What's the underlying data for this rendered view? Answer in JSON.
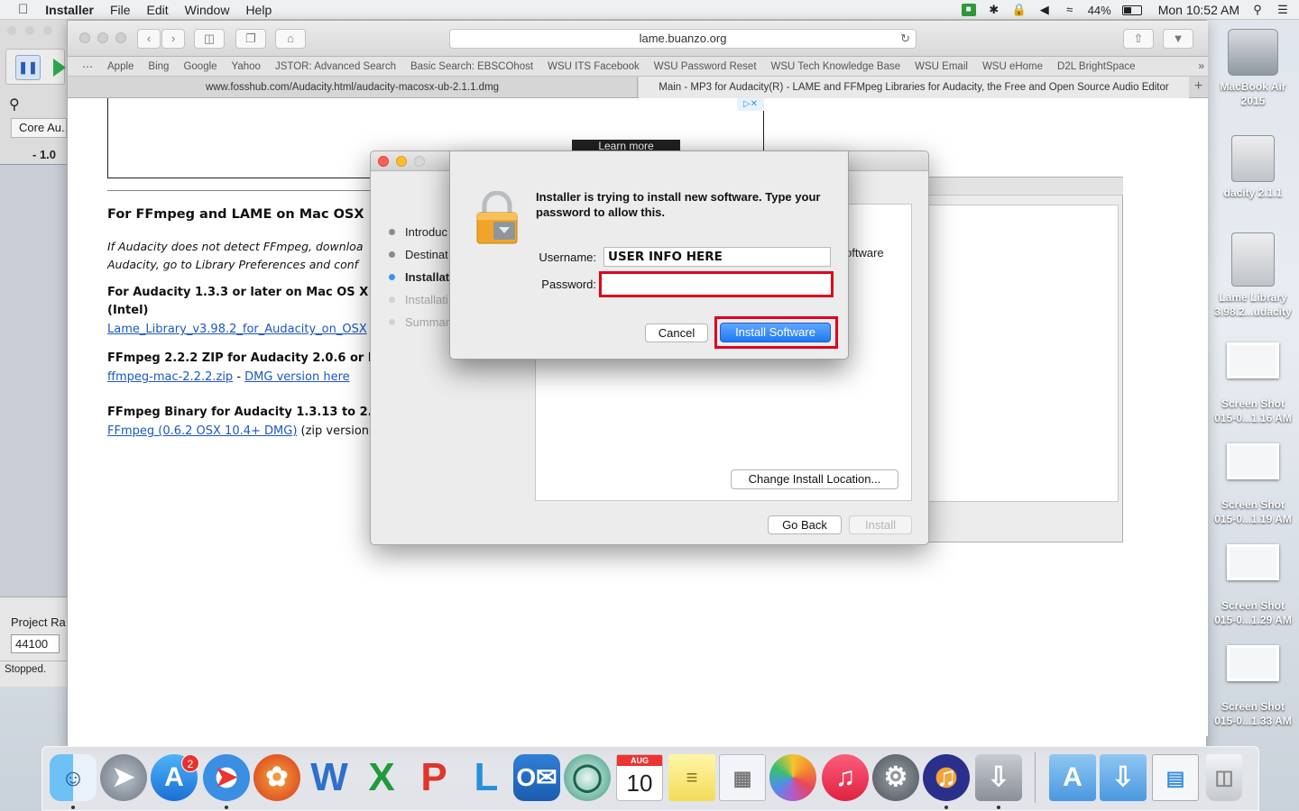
{
  "menubar": {
    "apple": "",
    "app": "Installer",
    "items": [
      "File",
      "Edit",
      "Window",
      "Help"
    ],
    "battery": "44%",
    "clock": "Mon 10:52 AM"
  },
  "audacity": {
    "device": "Core Au...",
    "meter": "- 1.0",
    "project_rate_label": "Project Ra",
    "project_rate_value": "44100",
    "status": "Stopped."
  },
  "safari": {
    "url": "lame.buanzo.org",
    "favorites": [
      "Apple",
      "Bing",
      "Google",
      "Yahoo",
      "JSTOR: Advanced Search",
      "Basic Search: EBSCOhost",
      "WSU ITS Facebook",
      "WSU Password Reset",
      "WSU Tech Knowledge Base",
      "WSU Email",
      "WSU eHome",
      "D2L BrightSpace"
    ],
    "tabs": [
      {
        "title": "www.fosshub.com/Audacity.html/audacity-macosx-ub-2.1.1.dmg"
      },
      {
        "title": "Main - MP3 for Audacity(R) - LAME and FFMpeg Libraries for Audacity, the Free and Open Source Audio Editor"
      }
    ]
  },
  "page": {
    "ad_button": "Learn more",
    "heading": "For FFmpeg and LAME on Mac OSX",
    "intro_line1": "If Audacity does not detect FFmpeg, downloa",
    "intro_line2": "Audacity, go to Library Preferences and conf",
    "section1_title": "For Audacity 1.3.3 or later on Mac OS X",
    "section1_sub": "(Intel)",
    "section1_link": "Lame_Library_v3.98.2_for_Audacity_on_OSX",
    "section2_title": "FFmpeg 2.2.2 ZIP for Audacity 2.0.6 or l",
    "section2_link1": "ffmpeg-mac-2.2.2.zip",
    "section2_sep": " - ",
    "section2_link2": "DMG version here",
    "section3_title": "FFmpeg Binary for Audacity 1.3.13 to 2.",
    "section3_link": "FFmpeg (0.6.2 OSX 10.4+ DMG)",
    "section3_rest": " (zip version"
  },
  "installer": {
    "steps": [
      {
        "label": "Introduc",
        "state": "done"
      },
      {
        "label": "Destinat",
        "state": "done"
      },
      {
        "label": "Installat",
        "state": "current"
      },
      {
        "label": "Installati",
        "state": "pending"
      },
      {
        "label": "Summar",
        "state": "pending"
      }
    ],
    "partial_text": "oftware",
    "change_location": "Change Install Location...",
    "go_back": "Go Back",
    "install": "Install"
  },
  "auth_dialog": {
    "message": "Installer is trying to install new software. Type your password to allow this.",
    "username_label": "Username:",
    "username_value": "USER INFO HERE",
    "password_label": "Password:",
    "password_value": "",
    "cancel": "Cancel",
    "confirm": "Install Software"
  },
  "desktop_icons": [
    {
      "label": "MacBook Air 2015",
      "kind": "internal-drive-icon"
    },
    {
      "label": "dacity 2.1.1",
      "kind": "disk-image-icon"
    },
    {
      "label": "Lame Library 3.98.2...udacity",
      "kind": "disk-image-icon"
    },
    {
      "label": "Screen Shot 015-0...1.16 AM",
      "kind": "screenshot-icon"
    },
    {
      "label": "Screen Shot 015-0...1.19 AM",
      "kind": "screenshot-icon"
    },
    {
      "label": "Screen Shot 015-0...1.29 AM",
      "kind": "screenshot-icon"
    },
    {
      "label": "Screen Shot 015-0...1.33 AM",
      "kind": "screenshot-icon"
    }
  ],
  "dock": {
    "app_store_badge": "2",
    "calendar_month": "AUG",
    "calendar_day": "10",
    "apps": [
      "finder",
      "launchpad",
      "app-store",
      "safari",
      "firefox",
      "word",
      "excel",
      "powerpoint",
      "lync",
      "outlook",
      "network",
      "calendar",
      "notes",
      "preview",
      "photos",
      "itunes",
      "system-preferences",
      "audacity",
      "installer",
      "applications-folder",
      "downloads-folder",
      "documents",
      "trash"
    ]
  },
  "colors": {
    "highlight_red": "#e0001b",
    "primary_button": "#1f78f2",
    "link": "#1a57c6"
  }
}
